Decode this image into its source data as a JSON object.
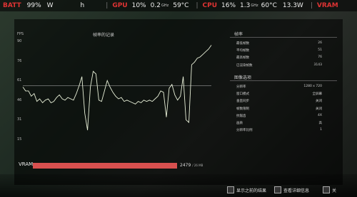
{
  "topbar": {
    "batt_label": "BATT",
    "batt_value": "99%",
    "batt_w": "W",
    "batt_h": "h",
    "gpu_label": "GPU",
    "gpu_util": "10%",
    "gpu_mem": "0.2",
    "gpu_mem_unit": "GHz",
    "gpu_temp": "59°C",
    "cpu_label": "CPU",
    "cpu_util": "16%",
    "cpu_clock": "1.3",
    "cpu_clock_unit": "GHz",
    "cpu_temp": "60°C",
    "cpu_power": "13.3W",
    "vram_label": "VRAM"
  },
  "chart": {
    "title": "帧率的记录",
    "fps_label": "FPS",
    "yticks": [
      "90",
      "76",
      "61",
      "46",
      "31",
      "15"
    ]
  },
  "chart_data": {
    "type": "line",
    "title": "帧率的记录",
    "ylabel": "FPS",
    "ylim": [
      15,
      90
    ],
    "series": [
      {
        "values": [
          55,
          52,
          52,
          48,
          50,
          44,
          46,
          43,
          45,
          46,
          43,
          44,
          47,
          49,
          46,
          45,
          47,
          46,
          45,
          50,
          56,
          63,
          35,
          22,
          55,
          67,
          65,
          45,
          44,
          52,
          60,
          55,
          51,
          48,
          46,
          47,
          44,
          45,
          44,
          43,
          42,
          44,
          43,
          45,
          44,
          45,
          44,
          46,
          48,
          52,
          51,
          32,
          54,
          57,
          49,
          45,
          48,
          63,
          30,
          28,
          72,
          74,
          77,
          78,
          80,
          82,
          84,
          87
        ]
      }
    ],
    "reference_line": 56
  },
  "vram": {
    "label": "VRAM",
    "value": "2479",
    "unit": "/ 26 MB",
    "fill_fraction": 1.0
  },
  "stats": {
    "header1": "帧率",
    "rows1": [
      {
        "k": "最低帧数",
        "v": "26"
      },
      {
        "k": "平均帧数",
        "v": "51"
      },
      {
        "k": "最高帧数",
        "v": "76"
      },
      {
        "k": "已渲染帧数",
        "v": "3143"
      }
    ],
    "header2": "图像选项",
    "rows2": [
      {
        "k": "分辨率",
        "v": "1280 x 720"
      },
      {
        "k": "窗口模式",
        "v": "全屏幕"
      },
      {
        "k": "垂直同步",
        "v": "关闭"
      },
      {
        "k": "帧数限制",
        "v": "关闭"
      },
      {
        "k": "抗锯齿",
        "v": "4X"
      },
      {
        "k": "画质",
        "v": "高"
      },
      {
        "k": "分辨率比例",
        "v": "1"
      }
    ]
  },
  "bottom": {
    "btn1": "显示之前的结果",
    "btn2": "查看详细信息",
    "btn3": "关"
  }
}
